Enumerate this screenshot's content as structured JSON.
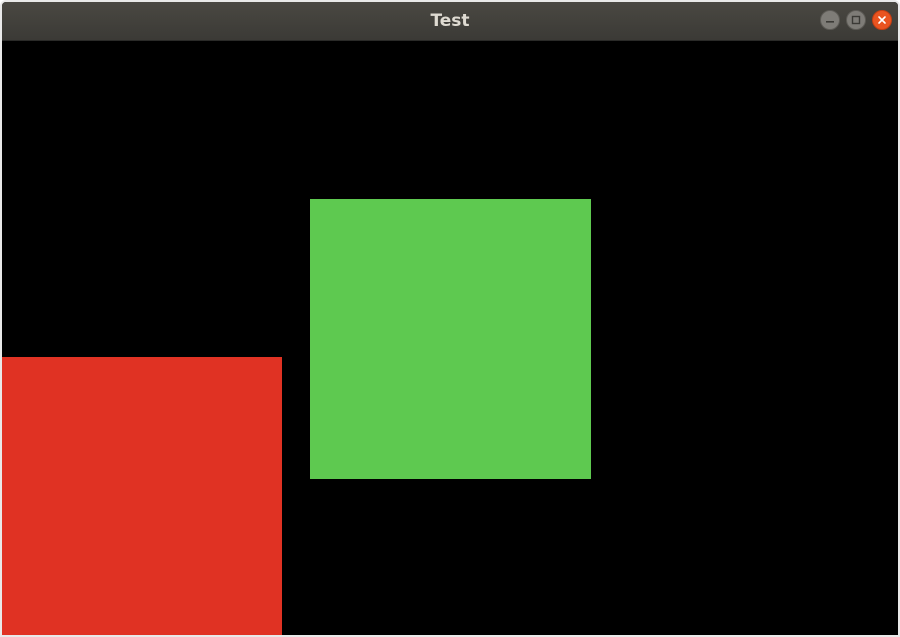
{
  "window": {
    "title": "Test"
  },
  "controls": {
    "minimize_icon": "minimize-icon",
    "maximize_icon": "maximize-icon",
    "close_icon": "close-icon"
  },
  "canvas": {
    "background": "#000000",
    "shapes": [
      {
        "name": "green-square",
        "color": "#5ec950"
      },
      {
        "name": "red-square",
        "color": "#e03223"
      }
    ]
  }
}
